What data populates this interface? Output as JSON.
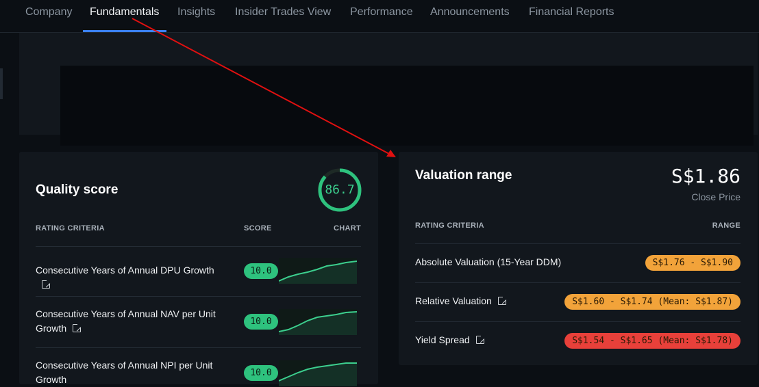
{
  "tabs": [
    {
      "label": "Company",
      "active": false
    },
    {
      "label": "Fundamentals",
      "active": true
    },
    {
      "label": "Insights",
      "active": false
    },
    {
      "label": "Insider Trades View",
      "active": false
    },
    {
      "label": "Performance",
      "active": false
    },
    {
      "label": "Announcements",
      "active": false
    },
    {
      "label": "Financial Reports",
      "active": false
    }
  ],
  "quality": {
    "title": "Quality score",
    "score": "86.7",
    "score_fraction": 0.867,
    "headers": {
      "criteria": "RATING CRITERIA",
      "score": "SCORE",
      "chart": "CHART"
    },
    "rows": [
      {
        "criteria": "Consecutive Years of Annual DPU Growth",
        "score": "10.0"
      },
      {
        "criteria": "Consecutive Years of Annual NAV per Unit Growth",
        "score": "10.0"
      },
      {
        "criteria": "Consecutive Years of Annual NPI per Unit Growth",
        "score": "10.0"
      }
    ]
  },
  "valuation": {
    "title": "Valuation range",
    "price": "S$1.86",
    "price_label": "Close Price",
    "headers": {
      "criteria": "RATING CRITERIA",
      "range": "RANGE"
    },
    "rows": [
      {
        "criteria": "Absolute Valuation (15-Year DDM)",
        "range": "S$1.76 - S$1.90",
        "color": "#f2a33a"
      },
      {
        "criteria": "Relative Valuation",
        "range": "S$1.60 - S$1.74 (Mean: S$1.87)",
        "color": "#f2a33a"
      },
      {
        "criteria": "Yield Spread",
        "range": "S$1.54 - S$1.65 (Mean: S$1.78)",
        "color": "#e8403a"
      }
    ]
  },
  "colors": {
    "accent": "#3b82f6",
    "good": "#2ec27e",
    "warn": "#f2a33a",
    "bad": "#e8403a",
    "annotation_arrow": "#e01010"
  },
  "icons": [
    "external-link-icon"
  ]
}
